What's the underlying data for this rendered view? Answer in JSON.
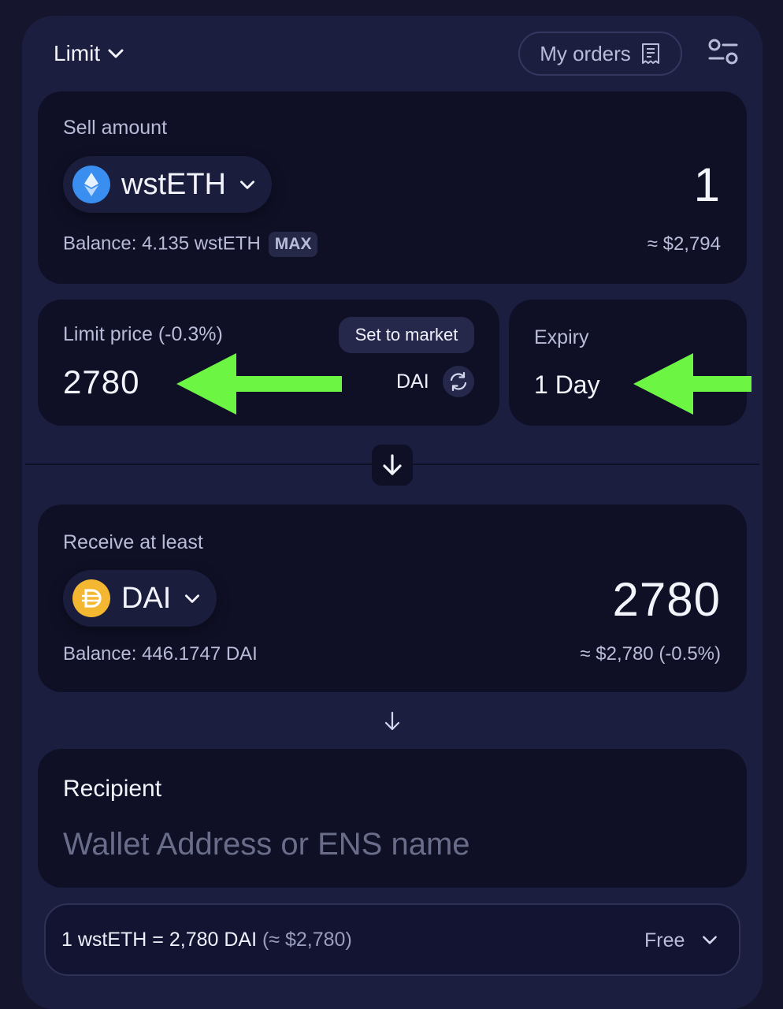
{
  "header": {
    "mode_label": "Limit",
    "my_orders_label": "My orders"
  },
  "sell": {
    "label": "Sell amount",
    "token": "wstETH",
    "amount": "1",
    "balance_label": "Balance: 4.135 wstETH",
    "max_label": "MAX",
    "usd_value": "≈ $2,794"
  },
  "limit_price": {
    "label": "Limit price (-0.3%)",
    "set_to_market_label": "Set to market",
    "value": "2780",
    "quote_token": "DAI"
  },
  "expiry": {
    "label": "Expiry",
    "value": "1 Day"
  },
  "receive": {
    "label": "Receive at least",
    "token": "DAI",
    "amount": "2780",
    "balance_label": "Balance: 446.1747 DAI",
    "usd_value": "≈ $2,780 (-0.5%)"
  },
  "recipient": {
    "label": "Recipient",
    "placeholder": "Wallet Address or ENS name"
  },
  "rate": {
    "text": "1 wstETH = 2,780 DAI",
    "usd": "(≈ $2,780)",
    "fee_label": "Free"
  },
  "colors": {
    "background": "#15162e",
    "panel": "#1c1e3f",
    "card": "#0f1026",
    "annotation_arrow": "#6cf542",
    "wsteth_icon": "#3a8ef0",
    "dai_icon": "#f4b731"
  }
}
